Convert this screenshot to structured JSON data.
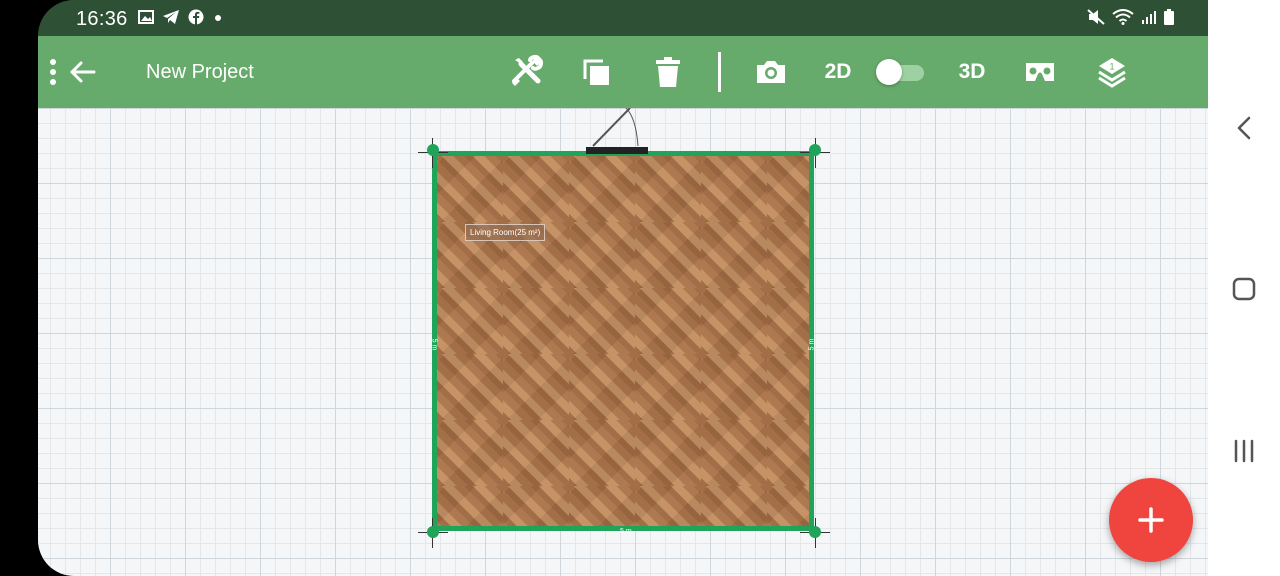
{
  "status_bar": {
    "time": "16:36",
    "left_icons": [
      "gallery-icon",
      "telegram-icon",
      "facebook-icon",
      "dot-icon"
    ],
    "right_icons": [
      "mute-icon",
      "wifi-icon",
      "signal-icon",
      "battery-icon"
    ]
  },
  "toolbar": {
    "title": "New Project",
    "mode_2d_label": "2D",
    "mode_3d_label": "3D",
    "toggle_on": true,
    "layers_badge": "1",
    "background_color": "#66ab6b"
  },
  "room": {
    "label": "Living Room(25 m²)",
    "dim_bottom": "5 m",
    "dim_left": "5 m",
    "dim_right": "5 m",
    "wall_color": "#1fa45a"
  },
  "fab": {
    "icon": "plus-icon",
    "color": "#f0453f"
  },
  "system_nav": {
    "back": "chevron-left-icon",
    "home": "home-square-icon",
    "recents": "recents-icon"
  }
}
